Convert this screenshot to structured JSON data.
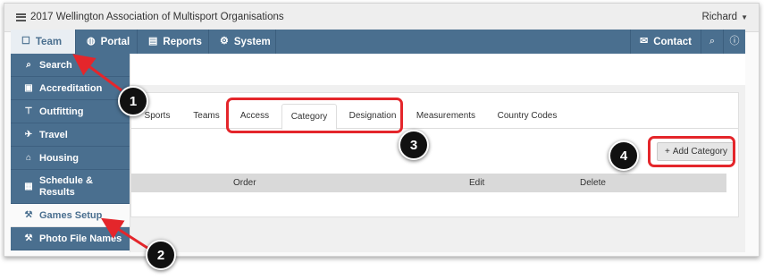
{
  "header": {
    "app_title": "2017 Wellington Association of Multisport Organisations",
    "user_name": "Richard"
  },
  "topnav": {
    "tabs": [
      {
        "label": "Team",
        "icon": "team-icon"
      },
      {
        "label": "Portal",
        "icon": "globe-icon"
      },
      {
        "label": "Reports",
        "icon": "report-icon"
      },
      {
        "label": "System",
        "icon": "gear-icon"
      }
    ],
    "contact_label": "Contact"
  },
  "sidebar": {
    "items": [
      {
        "label": "Search",
        "icon": "search-icon"
      },
      {
        "label": "Accreditation",
        "icon": "id-card-icon"
      },
      {
        "label": "Outfitting",
        "icon": "shirt-icon"
      },
      {
        "label": "Travel",
        "icon": "plane-icon"
      },
      {
        "label": "Housing",
        "icon": "home-icon"
      },
      {
        "label": "Schedule & Results",
        "icon": "calendar-icon"
      },
      {
        "label": "Games Setup",
        "icon": "wrench-icon"
      },
      {
        "label": "Photo File Names",
        "icon": "wrench-icon"
      }
    ]
  },
  "subtabs": [
    {
      "label": "Sports"
    },
    {
      "label": "Teams"
    },
    {
      "label": "Access"
    },
    {
      "label": "Category"
    },
    {
      "label": "Designation"
    },
    {
      "label": "Measurements"
    },
    {
      "label": "Country Codes"
    }
  ],
  "active_subtab": "Category",
  "add_button": {
    "label": "Add Category"
  },
  "table": {
    "columns": [
      "Order",
      "Edit",
      "Delete"
    ]
  },
  "callouts": [
    "1",
    "2",
    "3",
    "4"
  ],
  "colors": {
    "nav_blue": "#4a6f8f",
    "highlight_red": "#e4262b"
  }
}
